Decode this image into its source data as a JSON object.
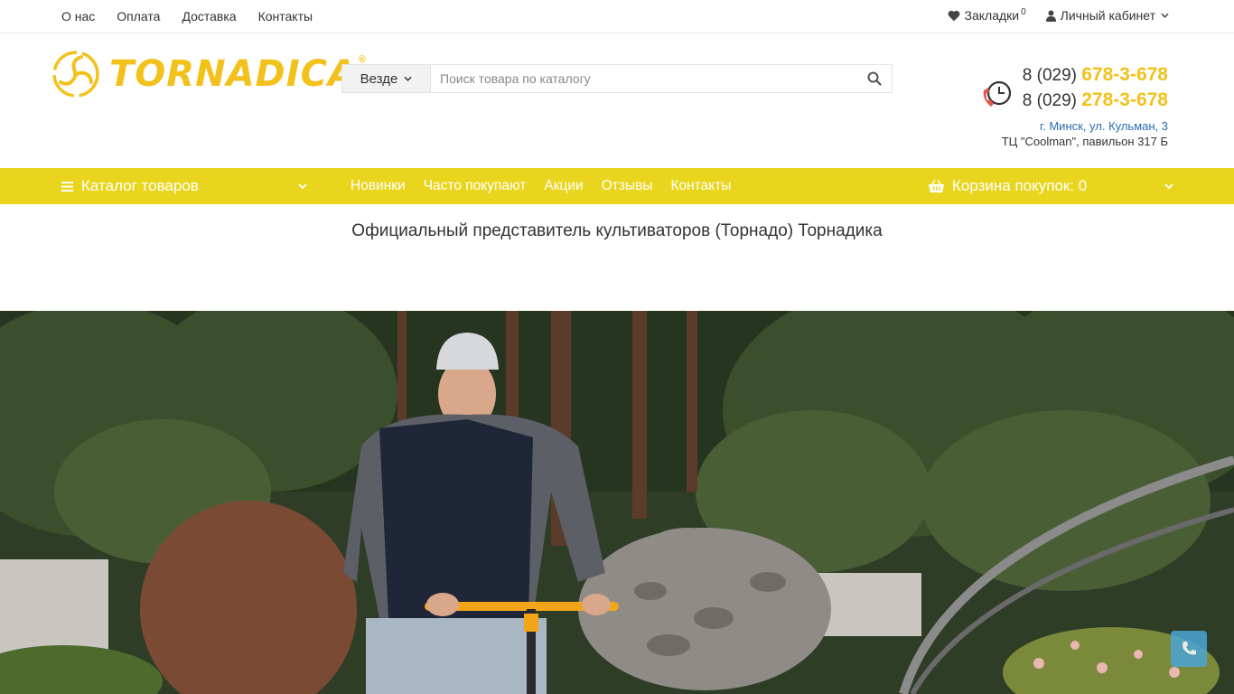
{
  "top_nav": {
    "links": [
      "О нас",
      "Оплата",
      "Доставка",
      "Контакты"
    ],
    "bookmarks_label": "Закладки",
    "bookmarks_count": "0",
    "account_label": "Личный кабинет"
  },
  "logo": {
    "text": "TORNADICA",
    "reg": "®"
  },
  "search": {
    "scope": "Везде",
    "placeholder": "Поиск товара по каталогу"
  },
  "contacts": {
    "phone1_prefix": "8 (029)",
    "phone1_number": "678-3-678",
    "phone2_prefix": "8 (029)",
    "phone2_number": "278-3-678",
    "address_line1": "г. Минск, ул. Кульман, 3",
    "address_line2": "ТЦ \"Coolman\", павильон 317 Б"
  },
  "navbar": {
    "catalog_label": "Каталог товаров",
    "links": [
      "Новинки",
      "Часто покупают",
      "Акции",
      "Отзывы",
      "Контакты"
    ],
    "cart_label": "Корзина покупок: 0"
  },
  "tagline": "Официальный представитель культиваторов (Торнадо) Торнадика",
  "colors": {
    "accent_yellow": "#ead51e",
    "logo_yellow": "#f3c11b",
    "link_blue": "#2a6db5",
    "call_button": "#4aa6d6"
  }
}
